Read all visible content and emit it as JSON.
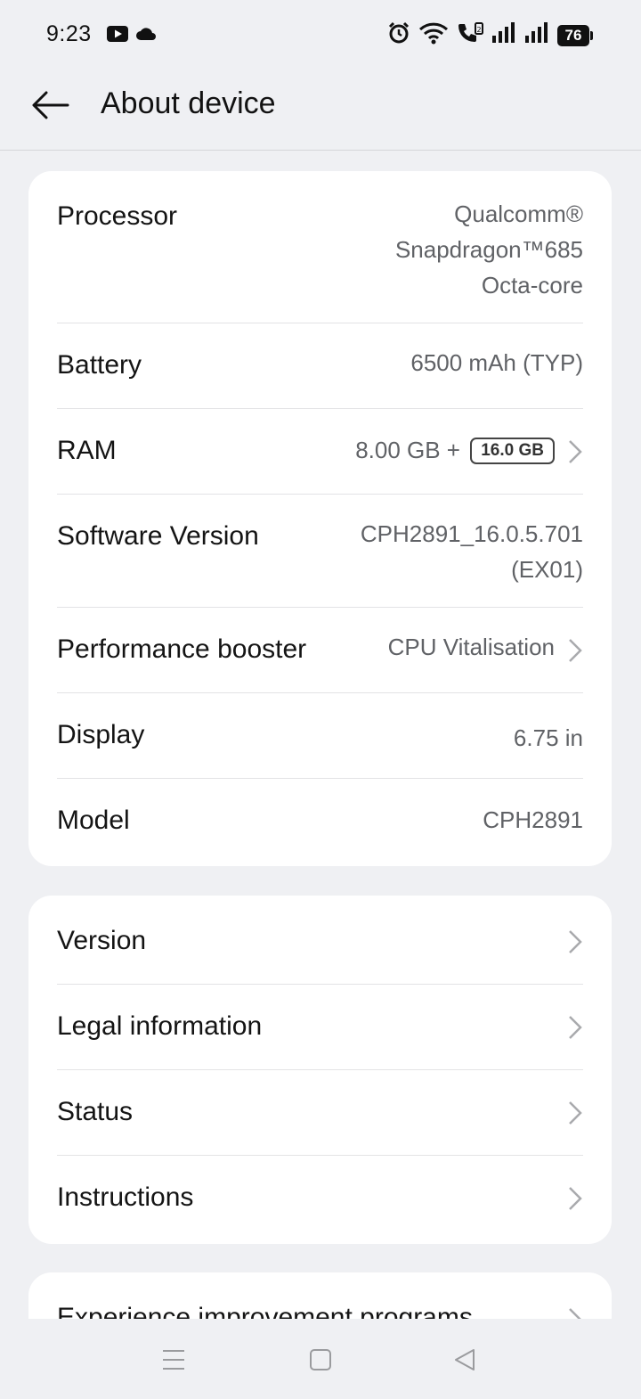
{
  "status_bar": {
    "time": "9:23",
    "battery_level": "76",
    "icons": [
      "youtube-icon",
      "cloud-icon",
      "alarm-icon",
      "wifi-icon",
      "volte-call-icon",
      "signal-1-icon",
      "signal-2-icon",
      "battery-icon"
    ]
  },
  "header": {
    "title": "About device"
  },
  "specs": {
    "processor": {
      "label": "Processor",
      "value_line1": "Qualcomm®",
      "value_line2": "Snapdragon™685",
      "value_line3": "Octa-core"
    },
    "battery": {
      "label": "Battery",
      "value": "6500 mAh (TYP)"
    },
    "ram": {
      "label": "RAM",
      "value": "8.00 GB +",
      "badge": "16.0 GB"
    },
    "software": {
      "label": "Software Version",
      "value_line1": "CPH2891_16.0.5.701",
      "value_line2": "(EX01)"
    },
    "performance": {
      "label": "Performance booster",
      "value": "CPU Vitalisation"
    },
    "display": {
      "label": "Display",
      "value": "6.75 in"
    },
    "model": {
      "label": "Model",
      "value": "CPH2891"
    }
  },
  "info_menu": {
    "items": [
      {
        "label": "Version"
      },
      {
        "label": "Legal information"
      },
      {
        "label": "Status"
      },
      {
        "label": "Instructions"
      }
    ]
  },
  "more_menu": {
    "partial_item": "Experience improvement programs"
  },
  "nav_bar": {
    "icons": [
      "recents-icon",
      "home-icon",
      "back-triangle-icon"
    ]
  }
}
